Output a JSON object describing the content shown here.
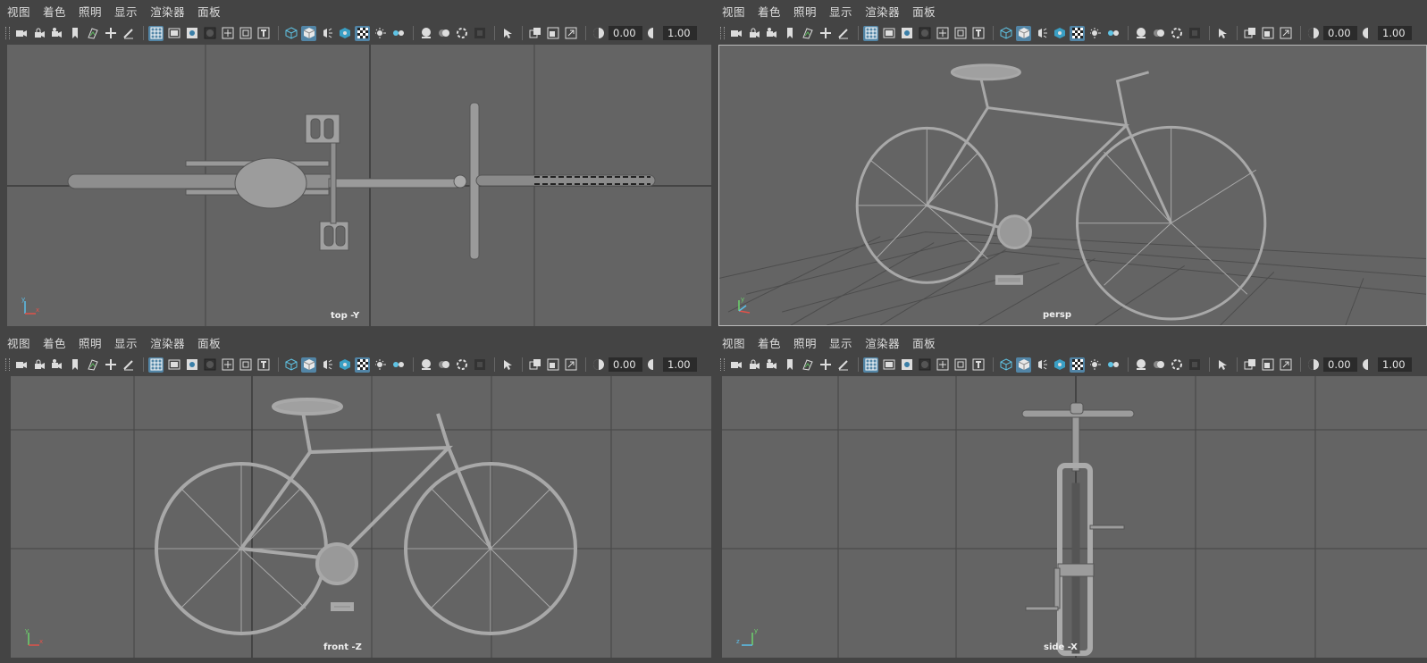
{
  "menu": [
    "视图",
    "着色",
    "照明",
    "显示",
    "渲染器",
    "面板"
  ],
  "toolbar": {
    "exposure": "0.00",
    "gamma": "1.00"
  },
  "icons": [
    "camera-icon",
    "lock-camera-icon",
    "camera-attr-icon",
    "bookmark-icon",
    "image-plane-icon",
    "pan-icon",
    "grease-pencil-icon",
    "grid-icon",
    "film-gate-icon",
    "resolution-gate-icon",
    "gate-mask-icon",
    "field-chart-icon",
    "safe-action-icon",
    "safe-title-icon",
    "wireframe-icon",
    "smooth-shade-icon",
    "default-lighting-icon",
    "textured-icon",
    "shadows-icon",
    "lights-icon",
    "ssao-icon",
    "motion-blur-icon",
    "anti-alias-icon",
    "depth-of-field-icon",
    "isolate-select-icon",
    "xray-icon",
    "xray-joints-icon",
    "backface-icon",
    "exposure-icon",
    "gamma-icon"
  ],
  "colors": {
    "accent": "#5285a6",
    "viewport": "#646464",
    "ui": "#444444"
  },
  "panes": [
    {
      "camera": "top -Y"
    },
    {
      "camera": "persp"
    },
    {
      "camera": "front -Z"
    },
    {
      "camera": "side -X"
    }
  ]
}
